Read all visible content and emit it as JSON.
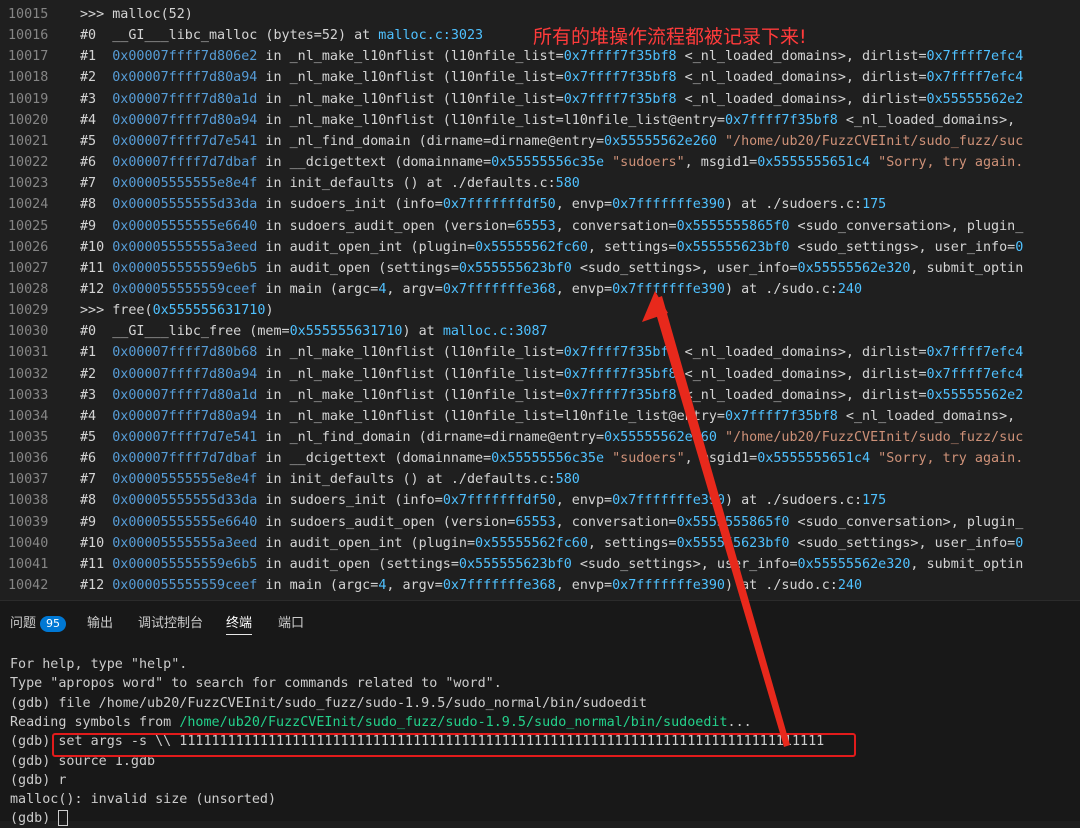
{
  "editor": {
    "lines": [
      {
        "ln": "10015",
        "parts": [
          {
            "t": ">>> malloc(52)",
            "c": "c-cmd"
          }
        ]
      },
      {
        "ln": "10016",
        "parts": [
          {
            "t": "#0  ",
            "c": "c-hash"
          },
          {
            "t": "__GI___libc_malloc (bytes=52) at ",
            "c": ""
          },
          {
            "t": "malloc.c:3023",
            "c": "c-file"
          }
        ]
      },
      {
        "ln": "10017",
        "parts": [
          {
            "t": "#1  ",
            "c": "c-hash"
          },
          {
            "t": "0x00007ffff7d806e2",
            "c": "c-addr"
          },
          {
            "t": " in _nl_make_l10nflist (l10nfile_list=",
            "c": ""
          },
          {
            "t": "0x7ffff7f35bf8",
            "c": "c-hex"
          },
          {
            "t": " <_nl_loaded_domains>, dirlist=",
            "c": ""
          },
          {
            "t": "0x7ffff7efc4",
            "c": "c-hex"
          }
        ]
      },
      {
        "ln": "10018",
        "parts": [
          {
            "t": "#2  ",
            "c": "c-hash"
          },
          {
            "t": "0x00007ffff7d80a94",
            "c": "c-addr"
          },
          {
            "t": " in _nl_make_l10nflist (l10nfile_list=",
            "c": ""
          },
          {
            "t": "0x7ffff7f35bf8",
            "c": "c-hex"
          },
          {
            "t": " <_nl_loaded_domains>, dirlist=",
            "c": ""
          },
          {
            "t": "0x7ffff7efc4",
            "c": "c-hex"
          }
        ]
      },
      {
        "ln": "10019",
        "parts": [
          {
            "t": "#3  ",
            "c": "c-hash"
          },
          {
            "t": "0x00007ffff7d80a1d",
            "c": "c-addr"
          },
          {
            "t": " in _nl_make_l10nflist (l10nfile_list=",
            "c": ""
          },
          {
            "t": "0x7ffff7f35bf8",
            "c": "c-hex"
          },
          {
            "t": " <_nl_loaded_domains>, dirlist=",
            "c": ""
          },
          {
            "t": "0x55555562e2",
            "c": "c-hex"
          }
        ]
      },
      {
        "ln": "10020",
        "parts": [
          {
            "t": "#4  ",
            "c": "c-hash"
          },
          {
            "t": "0x00007ffff7d80a94",
            "c": "c-addr"
          },
          {
            "t": " in _nl_make_l10nflist (l10nfile_list=l10nfile_list@entry=",
            "c": ""
          },
          {
            "t": "0x7ffff7f35bf8",
            "c": "c-hex"
          },
          {
            "t": " <_nl_loaded_domains>,",
            "c": ""
          }
        ]
      },
      {
        "ln": "10021",
        "parts": [
          {
            "t": "#5  ",
            "c": "c-hash"
          },
          {
            "t": "0x00007ffff7d7e541",
            "c": "c-addr"
          },
          {
            "t": " in _nl_find_domain (dirname=dirname@entry=",
            "c": ""
          },
          {
            "t": "0x55555562e260",
            "c": "c-hex"
          },
          {
            "t": " \"/home/ub20/FuzzCVEInit/sudo_fuzz/suc",
            "c": "c-str"
          }
        ]
      },
      {
        "ln": "10022",
        "parts": [
          {
            "t": "#6  ",
            "c": "c-hash"
          },
          {
            "t": "0x00007ffff7d7dbaf",
            "c": "c-addr"
          },
          {
            "t": " in __dcigettext (domainname=",
            "c": ""
          },
          {
            "t": "0x55555556c35e",
            "c": "c-hex"
          },
          {
            "t": " \"sudoers\"",
            "c": "c-str"
          },
          {
            "t": ", msgid1=",
            "c": ""
          },
          {
            "t": "0x5555555651c4",
            "c": "c-hex"
          },
          {
            "t": " \"Sorry, try again.",
            "c": "c-str"
          }
        ]
      },
      {
        "ln": "10023",
        "parts": [
          {
            "t": "#7  ",
            "c": "c-hash"
          },
          {
            "t": "0x00005555555e8e4f",
            "c": "c-addr"
          },
          {
            "t": " in init_defaults () at ./defaults.c:",
            "c": ""
          },
          {
            "t": "580",
            "c": "c-hex"
          }
        ]
      },
      {
        "ln": "10024",
        "parts": [
          {
            "t": "#8  ",
            "c": "c-hash"
          },
          {
            "t": "0x00005555555d33da",
            "c": "c-addr"
          },
          {
            "t": " in sudoers_init (info=",
            "c": ""
          },
          {
            "t": "0x7fffffffdf50",
            "c": "c-hex"
          },
          {
            "t": ", envp=",
            "c": ""
          },
          {
            "t": "0x7fffffffe390",
            "c": "c-hex"
          },
          {
            "t": ") at ./sudoers.c:",
            "c": ""
          },
          {
            "t": "175",
            "c": "c-hex"
          }
        ]
      },
      {
        "ln": "10025",
        "parts": [
          {
            "t": "#9  ",
            "c": "c-hash"
          },
          {
            "t": "0x00005555555e6640",
            "c": "c-addr"
          },
          {
            "t": " in sudoers_audit_open (version=",
            "c": ""
          },
          {
            "t": "65553",
            "c": "c-hex"
          },
          {
            "t": ", conversation=",
            "c": ""
          },
          {
            "t": "0x5555555865f0",
            "c": "c-hex"
          },
          {
            "t": " <sudo_conversation>, plugin_",
            "c": ""
          }
        ]
      },
      {
        "ln": "10026",
        "parts": [
          {
            "t": "#10 ",
            "c": "c-hash"
          },
          {
            "t": "0x00005555555a3eed",
            "c": "c-addr"
          },
          {
            "t": " in audit_open_int (plugin=",
            "c": ""
          },
          {
            "t": "0x55555562fc60",
            "c": "c-hex"
          },
          {
            "t": ", settings=",
            "c": ""
          },
          {
            "t": "0x555555623bf0",
            "c": "c-hex"
          },
          {
            "t": " <sudo_settings>, user_info=",
            "c": ""
          },
          {
            "t": "0",
            "c": "c-hex"
          }
        ]
      },
      {
        "ln": "10027",
        "parts": [
          {
            "t": "#11 ",
            "c": "c-hash"
          },
          {
            "t": "0x000055555559e6b5",
            "c": "c-addr"
          },
          {
            "t": " in audit_open (settings=",
            "c": ""
          },
          {
            "t": "0x555555623bf0",
            "c": "c-hex"
          },
          {
            "t": " <sudo_settings>, user_info=",
            "c": ""
          },
          {
            "t": "0x55555562e320",
            "c": "c-hex"
          },
          {
            "t": ", submit_optin",
            "c": ""
          }
        ]
      },
      {
        "ln": "10028",
        "parts": [
          {
            "t": "#12 ",
            "c": "c-hash"
          },
          {
            "t": "0x000055555559ceef",
            "c": "c-addr"
          },
          {
            "t": " in main (argc=",
            "c": ""
          },
          {
            "t": "4",
            "c": "c-hex"
          },
          {
            "t": ", argv=",
            "c": ""
          },
          {
            "t": "0x7fffffffe368",
            "c": "c-hex"
          },
          {
            "t": ", envp=",
            "c": ""
          },
          {
            "t": "0x7fffffffe390",
            "c": "c-hex"
          },
          {
            "t": ") at ./sudo.c:",
            "c": ""
          },
          {
            "t": "240",
            "c": "c-hex"
          }
        ]
      },
      {
        "ln": "10029",
        "parts": [
          {
            "t": ">>> free(",
            "c": "c-cmd"
          },
          {
            "t": "0x555555631710",
            "c": "c-hex"
          },
          {
            "t": ")",
            "c": ""
          }
        ]
      },
      {
        "ln": "10030",
        "parts": [
          {
            "t": "#0  ",
            "c": "c-hash"
          },
          {
            "t": "__GI___libc_free (mem=",
            "c": ""
          },
          {
            "t": "0x555555631710",
            "c": "c-hex"
          },
          {
            "t": ") at ",
            "c": ""
          },
          {
            "t": "malloc.c:3087",
            "c": "c-file"
          }
        ]
      },
      {
        "ln": "10031",
        "parts": [
          {
            "t": "#1  ",
            "c": "c-hash"
          },
          {
            "t": "0x00007ffff7d80b68",
            "c": "c-addr"
          },
          {
            "t": " in _nl_make_l10nflist (l10nfile_list=",
            "c": ""
          },
          {
            "t": "0x7ffff7f35bf8",
            "c": "c-hex"
          },
          {
            "t": " <_nl_loaded_domains>, dirlist=",
            "c": ""
          },
          {
            "t": "0x7ffff7efc4",
            "c": "c-hex"
          }
        ]
      },
      {
        "ln": "10032",
        "parts": [
          {
            "t": "#2  ",
            "c": "c-hash"
          },
          {
            "t": "0x00007ffff7d80a94",
            "c": "c-addr"
          },
          {
            "t": " in _nl_make_l10nflist (l10nfile_list=",
            "c": ""
          },
          {
            "t": "0x7ffff7f35bf8",
            "c": "c-hex"
          },
          {
            "t": " <_nl_loaded_domains>, dirlist=",
            "c": ""
          },
          {
            "t": "0x7ffff7efc4",
            "c": "c-hex"
          }
        ]
      },
      {
        "ln": "10033",
        "parts": [
          {
            "t": "#3  ",
            "c": "c-hash"
          },
          {
            "t": "0x00007ffff7d80a1d",
            "c": "c-addr"
          },
          {
            "t": " in _nl_make_l10nflist (l10nfile_list=",
            "c": ""
          },
          {
            "t": "0x7ffff7f35bf8",
            "c": "c-hex"
          },
          {
            "t": " <_nl_loaded_domains>, dirlist=",
            "c": ""
          },
          {
            "t": "0x55555562e2",
            "c": "c-hex"
          }
        ]
      },
      {
        "ln": "10034",
        "parts": [
          {
            "t": "#4  ",
            "c": "c-hash"
          },
          {
            "t": "0x00007ffff7d80a94",
            "c": "c-addr"
          },
          {
            "t": " in _nl_make_l10nflist (l10nfile_list=l10nfile_list@entry=",
            "c": ""
          },
          {
            "t": "0x7ffff7f35bf8",
            "c": "c-hex"
          },
          {
            "t": " <_nl_loaded_domains>,",
            "c": ""
          }
        ]
      },
      {
        "ln": "10035",
        "parts": [
          {
            "t": "#5  ",
            "c": "c-hash"
          },
          {
            "t": "0x00007ffff7d7e541",
            "c": "c-addr"
          },
          {
            "t": " in _nl_find_domain (dirname=dirname@entry=",
            "c": ""
          },
          {
            "t": "0x55555562e260",
            "c": "c-hex"
          },
          {
            "t": " \"/home/ub20/FuzzCVEInit/sudo_fuzz/suc",
            "c": "c-str"
          }
        ]
      },
      {
        "ln": "10036",
        "parts": [
          {
            "t": "#6  ",
            "c": "c-hash"
          },
          {
            "t": "0x00007ffff7d7dbaf",
            "c": "c-addr"
          },
          {
            "t": " in __dcigettext (domainname=",
            "c": ""
          },
          {
            "t": "0x55555556c35e",
            "c": "c-hex"
          },
          {
            "t": " \"sudoers\"",
            "c": "c-str"
          },
          {
            "t": ", msgid1=",
            "c": ""
          },
          {
            "t": "0x5555555651c4",
            "c": "c-hex"
          },
          {
            "t": " \"Sorry, try again.",
            "c": "c-str"
          }
        ]
      },
      {
        "ln": "10037",
        "parts": [
          {
            "t": "#7  ",
            "c": "c-hash"
          },
          {
            "t": "0x00005555555e8e4f",
            "c": "c-addr"
          },
          {
            "t": " in init_defaults () at ./defaults.c:",
            "c": ""
          },
          {
            "t": "580",
            "c": "c-hex"
          }
        ]
      },
      {
        "ln": "10038",
        "parts": [
          {
            "t": "#8  ",
            "c": "c-hash"
          },
          {
            "t": "0x00005555555d33da",
            "c": "c-addr"
          },
          {
            "t": " in sudoers_init (info=",
            "c": ""
          },
          {
            "t": "0x7fffffffdf50",
            "c": "c-hex"
          },
          {
            "t": ", envp=",
            "c": ""
          },
          {
            "t": "0x7fffffffe390",
            "c": "c-hex"
          },
          {
            "t": ") at ./sudoers.c:",
            "c": ""
          },
          {
            "t": "175",
            "c": "c-hex"
          }
        ]
      },
      {
        "ln": "10039",
        "parts": [
          {
            "t": "#9  ",
            "c": "c-hash"
          },
          {
            "t": "0x00005555555e6640",
            "c": "c-addr"
          },
          {
            "t": " in sudoers_audit_open (version=",
            "c": ""
          },
          {
            "t": "65553",
            "c": "c-hex"
          },
          {
            "t": ", conversation=",
            "c": ""
          },
          {
            "t": "0x5555555865f0",
            "c": "c-hex"
          },
          {
            "t": " <sudo_conversation>, plugin_",
            "c": ""
          }
        ]
      },
      {
        "ln": "10040",
        "parts": [
          {
            "t": "#10 ",
            "c": "c-hash"
          },
          {
            "t": "0x00005555555a3eed",
            "c": "c-addr"
          },
          {
            "t": " in audit_open_int (plugin=",
            "c": ""
          },
          {
            "t": "0x55555562fc60",
            "c": "c-hex"
          },
          {
            "t": ", settings=",
            "c": ""
          },
          {
            "t": "0x555555623bf0",
            "c": "c-hex"
          },
          {
            "t": " <sudo_settings>, user_info=",
            "c": ""
          },
          {
            "t": "0",
            "c": "c-hex"
          }
        ]
      },
      {
        "ln": "10041",
        "parts": [
          {
            "t": "#11 ",
            "c": "c-hash"
          },
          {
            "t": "0x000055555559e6b5",
            "c": "c-addr"
          },
          {
            "t": " in audit_open (settings=",
            "c": ""
          },
          {
            "t": "0x555555623bf0",
            "c": "c-hex"
          },
          {
            "t": " <sudo_settings>, user_info=",
            "c": ""
          },
          {
            "t": "0x55555562e320",
            "c": "c-hex"
          },
          {
            "t": ", submit_optin",
            "c": ""
          }
        ]
      },
      {
        "ln": "10042",
        "parts": [
          {
            "t": "#12 ",
            "c": "c-hash"
          },
          {
            "t": "0x000055555559ceef",
            "c": "c-addr"
          },
          {
            "t": " in main (argc=",
            "c": ""
          },
          {
            "t": "4",
            "c": "c-hex"
          },
          {
            "t": ", argv=",
            "c": ""
          },
          {
            "t": "0x7fffffffe368",
            "c": "c-hex"
          },
          {
            "t": ", envp=",
            "c": ""
          },
          {
            "t": "0x7fffffffe390",
            "c": "c-hex"
          },
          {
            "t": ") at ./sudo.c:",
            "c": ""
          },
          {
            "t": "240",
            "c": "c-hex"
          }
        ]
      }
    ]
  },
  "annotation": {
    "text": "所有的堆操作流程都被记录下来!",
    "color": "#ff3b3b"
  },
  "panel": {
    "tabs": [
      {
        "label": "问题",
        "badge": "95",
        "active": false
      },
      {
        "label": "输出",
        "active": false
      },
      {
        "label": "调试控制台",
        "active": false
      },
      {
        "label": "终端",
        "active": true
      },
      {
        "label": "端口",
        "active": false
      }
    ],
    "terminal": [
      [
        {
          "t": "For help, type \"help\".",
          "c": ""
        }
      ],
      [
        {
          "t": "Type \"apropos word\" to search for commands related to \"word\".",
          "c": ""
        }
      ],
      [
        {
          "t": "(gdb) file /home/ub20/FuzzCVEInit/sudo_fuzz/sudo-1.9.5/sudo_normal/bin/sudoedit",
          "c": ""
        }
      ],
      [
        {
          "t": "Reading symbols from ",
          "c": ""
        },
        {
          "t": "/home/ub20/FuzzCVEInit/sudo_fuzz/sudo-1.9.5/sudo_normal/bin/sudoedit",
          "c": "t-green"
        },
        {
          "t": "...",
          "c": ""
        }
      ],
      [
        {
          "t": "(gdb) set args -s \\\\ 11111111111111111111111111111111111111111111111111111111111111111111111111111111",
          "c": ""
        }
      ],
      [
        {
          "t": "(gdb) source 1.gdb",
          "c": ""
        }
      ],
      [
        {
          "t": "(gdb) r",
          "c": ""
        }
      ],
      [
        {
          "t": "malloc(): invalid size (unsorted)",
          "c": ""
        }
      ],
      [
        {
          "t": "(gdb) ",
          "c": ""
        }
      ]
    ]
  },
  "colors": {
    "highlight_box": "#e11b1b",
    "arrow": "#e8291c"
  }
}
